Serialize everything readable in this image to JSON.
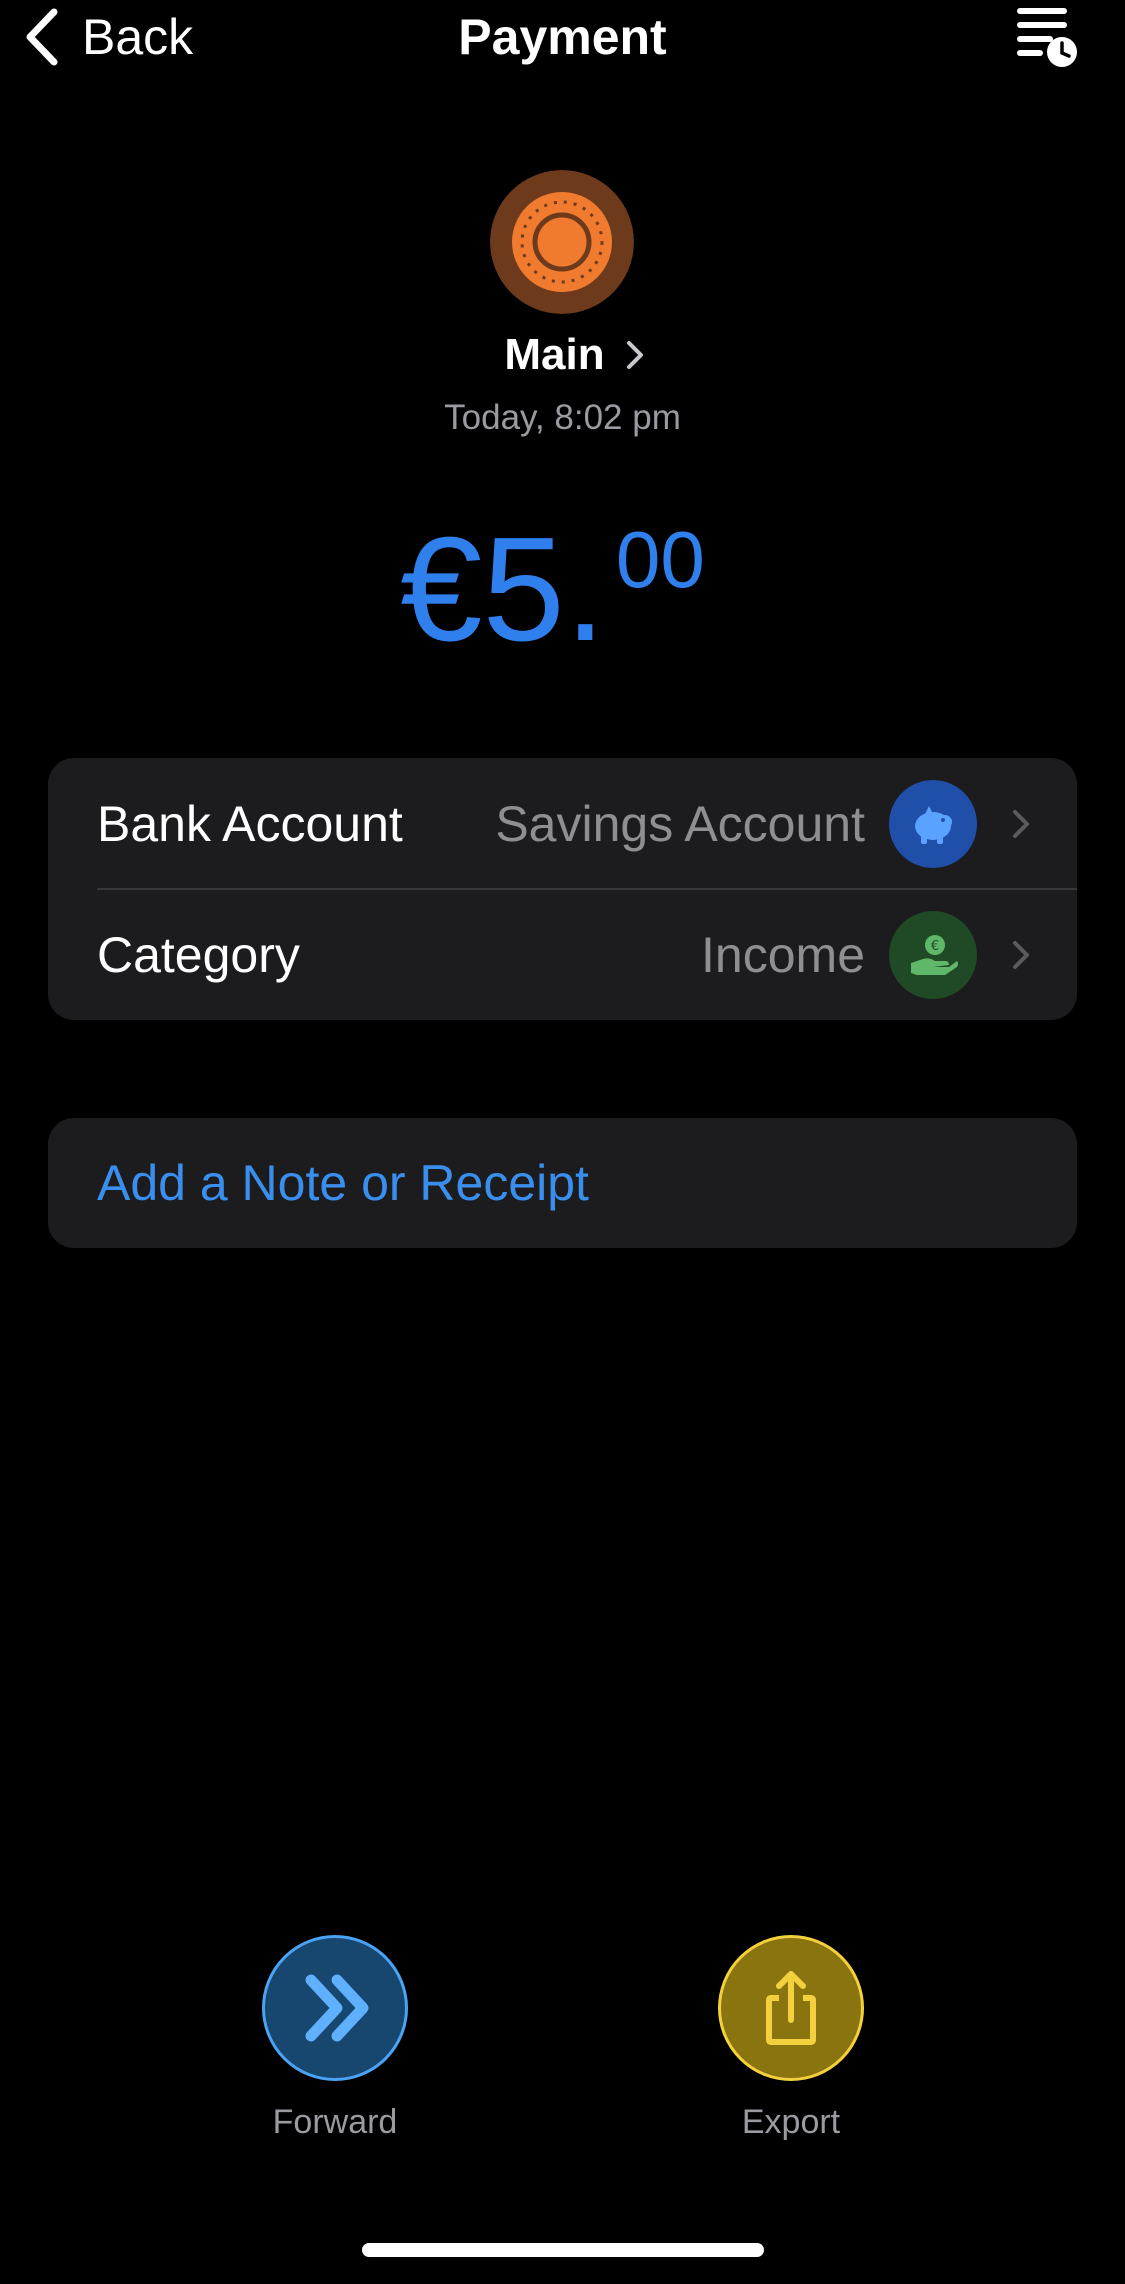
{
  "nav": {
    "back_label": "Back",
    "title": "Payment",
    "menu_icon": "list-clock-icon"
  },
  "header": {
    "account_icon": "sun-coin-icon",
    "account_name": "Main",
    "date": "Today, 8:02 pm",
    "amount_main": "€5.",
    "amount_cents": "00",
    "amount_color": "#2f80ed"
  },
  "details": {
    "rows": [
      {
        "label": "Bank Account",
        "value": "Savings Account",
        "icon": "piggy-bank-icon",
        "icon_color": "#2f6fdc"
      },
      {
        "label": "Category",
        "value": "Income",
        "icon": "hand-euro-coin-icon",
        "icon_color": "#2e6b34"
      }
    ]
  },
  "note": {
    "label": "Add a Note or Receipt",
    "color": "#3a8fee"
  },
  "actions": [
    {
      "label": "Forward",
      "icon": "double-chevron-right-icon",
      "color": "#4aa3f5"
    },
    {
      "label": "Export",
      "icon": "share-icon",
      "color": "#f3d03e"
    }
  ]
}
